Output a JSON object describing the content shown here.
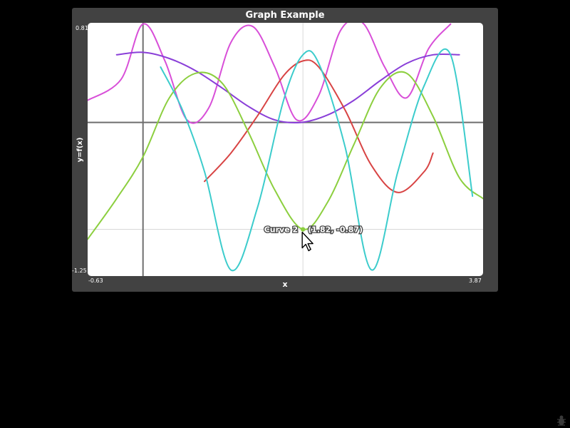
{
  "title": "Graph Example",
  "chart_data": {
    "type": "line",
    "title": "Graph Example",
    "xlabel": "x",
    "ylabel": "y=f(x)",
    "xlim": [
      -0.63,
      3.87
    ],
    "ylim": [
      -1.25,
      0.81
    ],
    "x_tick_labels": [
      "-0.63",
      "3.87"
    ],
    "y_tick_labels": [
      "0.81",
      "-1.25"
    ],
    "grid": true,
    "series": [
      {
        "color": "#d84fd8",
        "x": [
          -0.63,
          -0.25,
          0.0,
          0.25,
          0.5,
          0.75,
          1.0,
          1.25,
          1.5,
          1.75,
          2.0,
          2.25,
          2.5,
          2.75,
          3.0,
          3.25,
          3.5
        ],
        "y": [
          0.18,
          0.35,
          0.8,
          0.5,
          0.02,
          0.12,
          0.65,
          0.78,
          0.45,
          0.02,
          0.22,
          0.75,
          0.81,
          0.45,
          0.2,
          0.6,
          0.8
        ]
      },
      {
        "color": "#8a3fd8",
        "x": [
          -0.3,
          0.0,
          0.3,
          0.6,
          0.9,
          1.2,
          1.5,
          1.8,
          2.1,
          2.4,
          2.7,
          3.0,
          3.3,
          3.6
        ],
        "y": [
          0.55,
          0.57,
          0.52,
          0.42,
          0.28,
          0.13,
          0.02,
          0.0,
          0.06,
          0.18,
          0.34,
          0.48,
          0.55,
          0.55
        ]
      },
      {
        "color": "#d84444",
        "x": [
          0.7,
          1.0,
          1.3,
          1.6,
          1.82,
          2.0,
          2.3,
          2.6,
          2.9,
          3.2,
          3.3
        ],
        "y": [
          -0.48,
          -0.25,
          0.05,
          0.38,
          0.5,
          0.45,
          0.1,
          -0.35,
          -0.57,
          -0.4,
          -0.25
        ]
      },
      {
        "name": "Curve 2",
        "color": "#8ccf3f",
        "x": [
          -0.63,
          -0.3,
          0.0,
          0.3,
          0.6,
          0.9,
          1.2,
          1.5,
          1.82,
          2.1,
          2.4,
          2.7,
          3.0,
          3.3,
          3.6,
          3.87
        ],
        "y": [
          -0.95,
          -0.62,
          -0.28,
          0.2,
          0.4,
          0.32,
          -0.08,
          -0.55,
          -0.87,
          -0.65,
          -0.18,
          0.28,
          0.4,
          0.05,
          -0.45,
          -0.62
        ]
      },
      {
        "color": "#3ccccc",
        "x": [
          0.2,
          0.45,
          0.7,
          1.0,
          1.3,
          1.6,
          1.82,
          2.0,
          2.3,
          2.6,
          2.9,
          3.2,
          3.5,
          3.75
        ],
        "y": [
          0.45,
          0.1,
          -0.4,
          -1.2,
          -0.7,
          0.18,
          0.55,
          0.48,
          -0.2,
          -1.2,
          -0.4,
          0.3,
          0.55,
          -0.6
        ]
      }
    ],
    "highlight": {
      "series": "Curve 2",
      "x": 1.82,
      "y": -0.87,
      "label": "Curve 2",
      "value_text": "(1.82, -0.87)"
    }
  },
  "icons": {
    "cursor": "mouse-pointer-icon",
    "corner": "bug-icon"
  }
}
